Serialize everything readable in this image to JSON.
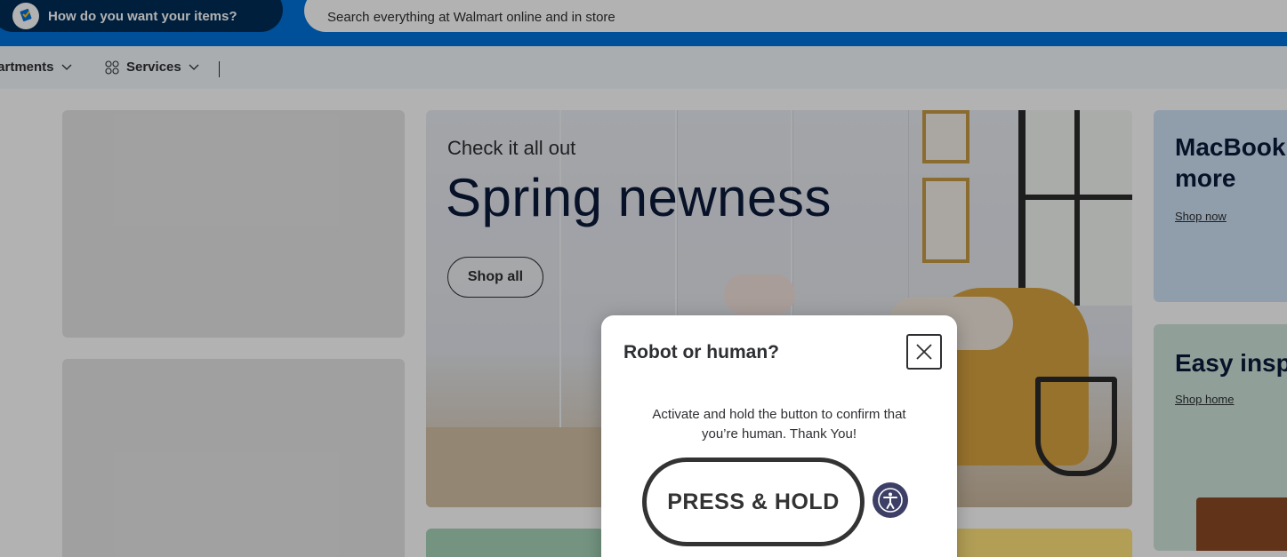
{
  "header": {
    "fulfillment_label": "How do you want your items?",
    "search_placeholder": "Search everything at Walmart online and in store"
  },
  "nav": {
    "departments_label": "Departments",
    "departments_visible": "partments",
    "services_label": "Services"
  },
  "hero": {
    "kicker": "Check it all out",
    "title": "Spring newness",
    "button_label": "Shop all"
  },
  "side_cards": [
    {
      "title_line1": "MacBook Air & more",
      "title_visible_1": "MacBook A",
      "title_visible_2": "more",
      "link": "Shop now"
    },
    {
      "title": "Easy inspo",
      "title_visible": "Easy inspo",
      "link": "Shop home"
    }
  ],
  "dialog": {
    "title": "Robot or human?",
    "message": "Activate and hold the button to confirm that you’re human. Thank You!",
    "press_hold_label": "PRESS & HOLD"
  },
  "colors": {
    "brand_blue": "#0071dc",
    "brand_navy": "#002d58",
    "spark_yellow": "#ffc220",
    "accessibility_button": "#3d3f66"
  },
  "icons": {
    "fulfillment": "fulfillment-icon",
    "services": "services-grid-icon",
    "chevron": "chevron-down-icon",
    "close": "close-icon",
    "accessibility": "accessibility-icon"
  }
}
